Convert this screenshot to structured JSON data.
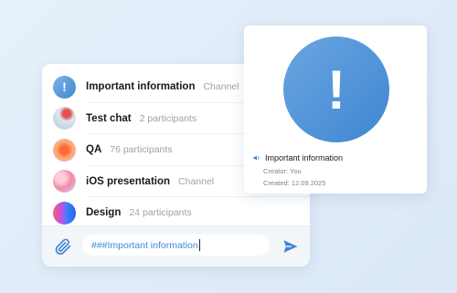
{
  "chats": [
    {
      "name": "Important information",
      "meta": "Channel",
      "avatar_glyph": "!"
    },
    {
      "name": "Test chat",
      "meta": "2 participants"
    },
    {
      "name": "QA",
      "meta": "76 participants"
    },
    {
      "name": "iOS presentation",
      "meta": "Channel"
    },
    {
      "name": "Design",
      "meta": "24 participants"
    }
  ],
  "composer": {
    "text": "###Important information",
    "attach_icon": "paperclip-icon",
    "send_icon": "send-icon"
  },
  "info_card": {
    "glyph": "!",
    "title": "Important information",
    "creator": "Creator: You",
    "created": "Created: 12.09.2025",
    "title_icon": "megaphone-icon"
  },
  "colors": {
    "accent": "#3f86d2",
    "background": "#dfebf8",
    "meta_text": "#9aa3ad"
  }
}
